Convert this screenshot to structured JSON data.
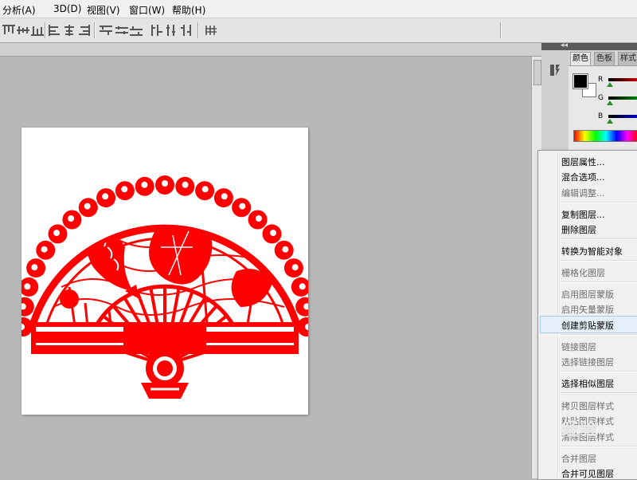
{
  "menubar": {
    "items": [
      {
        "label": "分析(A)"
      },
      {
        "label": "3D(D)"
      },
      {
        "label": "视图(V)"
      },
      {
        "label": "窗口(W)"
      },
      {
        "label": "帮助(H)"
      }
    ]
  },
  "options_bar": {
    "icons": [
      "align-top-edges-icon",
      "align-vertical-centers-icon",
      "align-bottom-edges-icon",
      "align-left-edges-icon",
      "align-horizontal-centers-icon",
      "align-right-edges-icon",
      "distribute-top-icon",
      "distribute-vertical-centers-icon",
      "distribute-bottom-icon",
      "distribute-left-icon",
      "distribute-horizontal-centers-icon",
      "distribute-right-icon",
      "auto-align-layers-icon"
    ]
  },
  "dock": {
    "collapse_glyph": "◂◂",
    "tabs": [
      {
        "label": "颜色",
        "active": true
      },
      {
        "label": "色板",
        "active": false
      },
      {
        "label": "样式",
        "active": false
      }
    ],
    "channels": [
      {
        "label": "R",
        "color": "#c00000"
      },
      {
        "label": "G",
        "color": "#008000"
      },
      {
        "label": "B",
        "color": "#0000c0"
      }
    ],
    "foreground_color": "#000000",
    "background_color": "#ffffff"
  },
  "context_menu": {
    "items": [
      {
        "label": "图层属性...",
        "disabled": false
      },
      {
        "label": "混合选项...",
        "disabled": false
      },
      {
        "label": "编辑调整...",
        "disabled": true
      },
      {
        "label": "复制图层...",
        "disabled": false
      },
      {
        "label": "删除图层",
        "disabled": false
      },
      {
        "label": "转换为智能对象",
        "disabled": false
      },
      {
        "label": "栅格化图层",
        "disabled": true
      },
      {
        "label": "启用图层蒙版",
        "disabled": true
      },
      {
        "label": "启用矢量蒙版",
        "disabled": true
      },
      {
        "label": "创建剪贴蒙版",
        "disabled": false,
        "highlighted": true
      },
      {
        "label": "链接图层",
        "disabled": true
      },
      {
        "label": "选择链接图层",
        "disabled": true
      },
      {
        "label": "选择相似图层",
        "disabled": false
      },
      {
        "label": "拷贝图层样式",
        "disabled": true
      },
      {
        "label": "粘贴图层样式",
        "disabled": true
      },
      {
        "label": "清除图层样式",
        "disabled": true
      },
      {
        "label": "合并图层",
        "disabled": true
      },
      {
        "label": "合并可见图层",
        "disabled": false
      }
    ]
  },
  "document": {
    "artwork": "red paper-cut fan with lotus and koi",
    "art_color": "#ff0000"
  },
  "watermark": {
    "text": "经验"
  }
}
